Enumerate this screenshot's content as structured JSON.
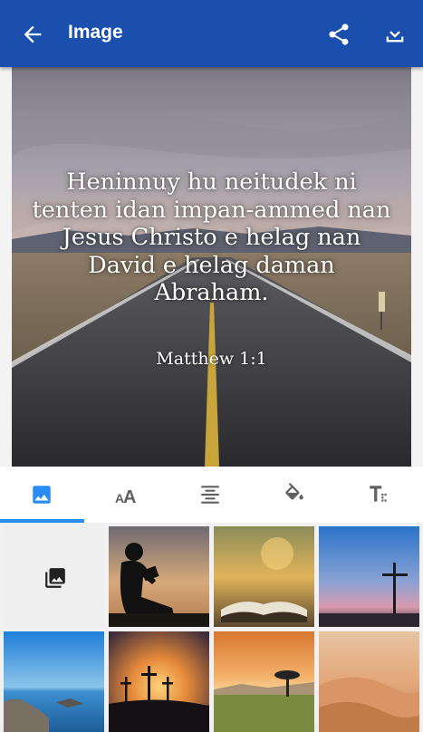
{
  "appbar": {
    "title": "Image",
    "back_icon": "arrow-left-icon",
    "share_icon": "share-icon",
    "download_icon": "download-icon",
    "color": "#1a4fad"
  },
  "preview": {
    "verse": "Heninnuy hu neitudek ni tenten idan impan-ammed nan Jesus Christo e helag nan David e helag daman Abraham.",
    "reference": "Matthew 1:1"
  },
  "tabs": [
    {
      "name": "background-image",
      "icon": "image-icon",
      "selected": true
    },
    {
      "name": "font",
      "icon": "font-size-icon",
      "selected": false
    },
    {
      "name": "alignment",
      "icon": "align-center-icon",
      "selected": false
    },
    {
      "name": "color",
      "icon": "paint-bucket-icon",
      "selected": false
    },
    {
      "name": "text-style",
      "icon": "text-format-icon",
      "selected": false
    }
  ],
  "gallery": {
    "picker_icon": "photo-library-icon",
    "thumbnails": [
      "reading-silhouette",
      "open-bible-sunset",
      "cross-dusk",
      "rocky-coast-sea",
      "three-crosses-sunset",
      "savanna-tree-sunset",
      "desert-dunes"
    ]
  },
  "colors": {
    "accent": "#2a8cf0",
    "icon_gray": "#616161",
    "selected_icon": "#2a8cf0"
  }
}
